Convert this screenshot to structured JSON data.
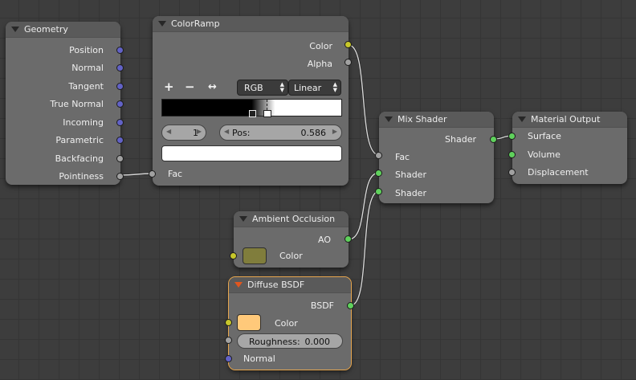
{
  "colors": {
    "vector_socket": "#6262c6",
    "float_socket": "#a1a1a1",
    "shader_socket": "#5fd15c",
    "color_socket": "#c7c72b",
    "ao_color": "#807d3c",
    "diffuse_color": "#ffc97a",
    "selected_outline": "#e8a74e"
  },
  "geometry": {
    "title": "Geometry",
    "outputs": [
      "Position",
      "Normal",
      "Tangent",
      "True Normal",
      "Incoming",
      "Parametric",
      "Backfacing",
      "Pointiness"
    ]
  },
  "colorramp": {
    "title": "ColorRamp",
    "out_color": "Color",
    "out_alpha": "Alpha",
    "add_icon": "+",
    "remove_icon": "−",
    "flip_icon": "↔",
    "color_mode": "RGB",
    "interpolation": "Linear",
    "stop_index": "1",
    "pos_label": "Pos:",
    "pos_value": "0.586",
    "in_fac": "Fac"
  },
  "mix": {
    "title": "Mix Shader",
    "out_shader": "Shader",
    "in_fac": "Fac",
    "in_shader1": "Shader",
    "in_shader2": "Shader"
  },
  "output": {
    "title": "Material Output",
    "surface": "Surface",
    "volume": "Volume",
    "displacement": "Displacement"
  },
  "ao": {
    "title": "Ambient Occlusion",
    "out_ao": "AO",
    "in_color": "Color"
  },
  "diffuse": {
    "title": "Diffuse BSDF",
    "out_bsdf": "BSDF",
    "in_color": "Color",
    "roughness_label": "Roughness:",
    "roughness_value": "0.000",
    "in_normal": "Normal"
  }
}
